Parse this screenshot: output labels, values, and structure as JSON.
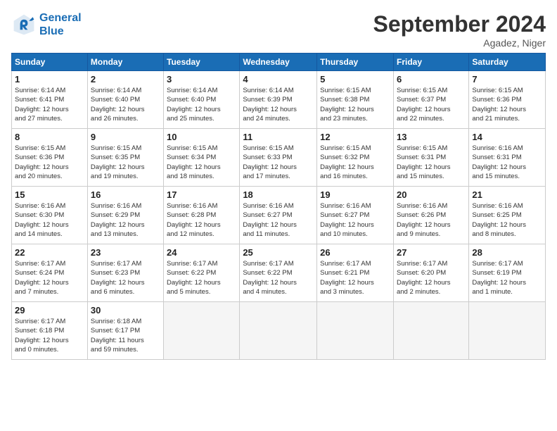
{
  "header": {
    "logo_line1": "General",
    "logo_line2": "Blue",
    "month_title": "September 2024",
    "location": "Agadez, Niger"
  },
  "weekdays": [
    "Sunday",
    "Monday",
    "Tuesday",
    "Wednesday",
    "Thursday",
    "Friday",
    "Saturday"
  ],
  "weeks": [
    [
      {
        "day": "1",
        "info": "Sunrise: 6:14 AM\nSunset: 6:41 PM\nDaylight: 12 hours\nand 27 minutes."
      },
      {
        "day": "2",
        "info": "Sunrise: 6:14 AM\nSunset: 6:40 PM\nDaylight: 12 hours\nand 26 minutes."
      },
      {
        "day": "3",
        "info": "Sunrise: 6:14 AM\nSunset: 6:40 PM\nDaylight: 12 hours\nand 25 minutes."
      },
      {
        "day": "4",
        "info": "Sunrise: 6:14 AM\nSunset: 6:39 PM\nDaylight: 12 hours\nand 24 minutes."
      },
      {
        "day": "5",
        "info": "Sunrise: 6:15 AM\nSunset: 6:38 PM\nDaylight: 12 hours\nand 23 minutes."
      },
      {
        "day": "6",
        "info": "Sunrise: 6:15 AM\nSunset: 6:37 PM\nDaylight: 12 hours\nand 22 minutes."
      },
      {
        "day": "7",
        "info": "Sunrise: 6:15 AM\nSunset: 6:36 PM\nDaylight: 12 hours\nand 21 minutes."
      }
    ],
    [
      {
        "day": "8",
        "info": "Sunrise: 6:15 AM\nSunset: 6:36 PM\nDaylight: 12 hours\nand 20 minutes."
      },
      {
        "day": "9",
        "info": "Sunrise: 6:15 AM\nSunset: 6:35 PM\nDaylight: 12 hours\nand 19 minutes."
      },
      {
        "day": "10",
        "info": "Sunrise: 6:15 AM\nSunset: 6:34 PM\nDaylight: 12 hours\nand 18 minutes."
      },
      {
        "day": "11",
        "info": "Sunrise: 6:15 AM\nSunset: 6:33 PM\nDaylight: 12 hours\nand 17 minutes."
      },
      {
        "day": "12",
        "info": "Sunrise: 6:15 AM\nSunset: 6:32 PM\nDaylight: 12 hours\nand 16 minutes."
      },
      {
        "day": "13",
        "info": "Sunrise: 6:15 AM\nSunset: 6:31 PM\nDaylight: 12 hours\nand 15 minutes."
      },
      {
        "day": "14",
        "info": "Sunrise: 6:16 AM\nSunset: 6:31 PM\nDaylight: 12 hours\nand 15 minutes."
      }
    ],
    [
      {
        "day": "15",
        "info": "Sunrise: 6:16 AM\nSunset: 6:30 PM\nDaylight: 12 hours\nand 14 minutes."
      },
      {
        "day": "16",
        "info": "Sunrise: 6:16 AM\nSunset: 6:29 PM\nDaylight: 12 hours\nand 13 minutes."
      },
      {
        "day": "17",
        "info": "Sunrise: 6:16 AM\nSunset: 6:28 PM\nDaylight: 12 hours\nand 12 minutes."
      },
      {
        "day": "18",
        "info": "Sunrise: 6:16 AM\nSunset: 6:27 PM\nDaylight: 12 hours\nand 11 minutes."
      },
      {
        "day": "19",
        "info": "Sunrise: 6:16 AM\nSunset: 6:27 PM\nDaylight: 12 hours\nand 10 minutes."
      },
      {
        "day": "20",
        "info": "Sunrise: 6:16 AM\nSunset: 6:26 PM\nDaylight: 12 hours\nand 9 minutes."
      },
      {
        "day": "21",
        "info": "Sunrise: 6:16 AM\nSunset: 6:25 PM\nDaylight: 12 hours\nand 8 minutes."
      }
    ],
    [
      {
        "day": "22",
        "info": "Sunrise: 6:17 AM\nSunset: 6:24 PM\nDaylight: 12 hours\nand 7 minutes."
      },
      {
        "day": "23",
        "info": "Sunrise: 6:17 AM\nSunset: 6:23 PM\nDaylight: 12 hours\nand 6 minutes."
      },
      {
        "day": "24",
        "info": "Sunrise: 6:17 AM\nSunset: 6:22 PM\nDaylight: 12 hours\nand 5 minutes."
      },
      {
        "day": "25",
        "info": "Sunrise: 6:17 AM\nSunset: 6:22 PM\nDaylight: 12 hours\nand 4 minutes."
      },
      {
        "day": "26",
        "info": "Sunrise: 6:17 AM\nSunset: 6:21 PM\nDaylight: 12 hours\nand 3 minutes."
      },
      {
        "day": "27",
        "info": "Sunrise: 6:17 AM\nSunset: 6:20 PM\nDaylight: 12 hours\nand 2 minutes."
      },
      {
        "day": "28",
        "info": "Sunrise: 6:17 AM\nSunset: 6:19 PM\nDaylight: 12 hours\nand 1 minute."
      }
    ],
    [
      {
        "day": "29",
        "info": "Sunrise: 6:17 AM\nSunset: 6:18 PM\nDaylight: 12 hours\nand 0 minutes."
      },
      {
        "day": "30",
        "info": "Sunrise: 6:18 AM\nSunset: 6:17 PM\nDaylight: 11 hours\nand 59 minutes."
      },
      {
        "day": "",
        "info": ""
      },
      {
        "day": "",
        "info": ""
      },
      {
        "day": "",
        "info": ""
      },
      {
        "day": "",
        "info": ""
      },
      {
        "day": "",
        "info": ""
      }
    ]
  ]
}
